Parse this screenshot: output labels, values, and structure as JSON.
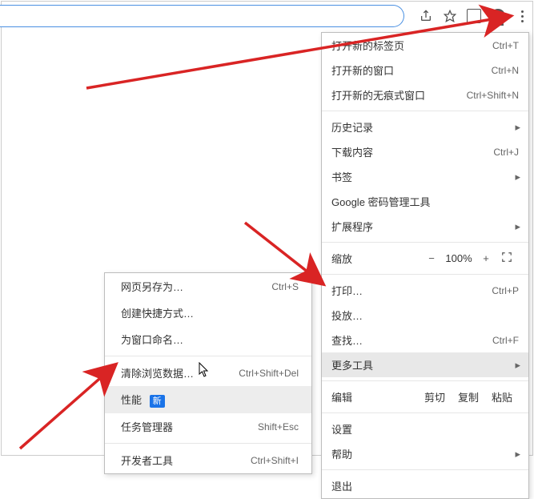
{
  "toolbar": {
    "share_icon": "share-icon",
    "star_icon": "star-icon",
    "extension_icon": "extension-icon",
    "profile_icon": "profile-icon",
    "kebab_icon": "kebab-menu-icon"
  },
  "main_menu": {
    "items": [
      {
        "label": "打开新的标签页",
        "shortcut": "Ctrl+T"
      },
      {
        "label": "打开新的窗口",
        "shortcut": "Ctrl+N"
      },
      {
        "label": "打开新的无痕式窗口",
        "shortcut": "Ctrl+Shift+N"
      }
    ],
    "history": {
      "label": "历史记录",
      "submenu": "▸"
    },
    "downloads": {
      "label": "下载内容",
      "shortcut": "Ctrl+J"
    },
    "bookmarks": {
      "label": "书签",
      "submenu": "▸"
    },
    "passwords": {
      "label": "Google 密码管理工具"
    },
    "extensions": {
      "label": "扩展程序",
      "submenu": "▸"
    },
    "zoom": {
      "label": "缩放",
      "minus": "−",
      "pct": "100%",
      "plus": "+",
      "fullscreen": "⛶"
    },
    "print": {
      "label": "打印…",
      "shortcut": "Ctrl+P"
    },
    "cast": {
      "label": "投放…"
    },
    "find": {
      "label": "查找…",
      "shortcut": "Ctrl+F"
    },
    "more_tools": {
      "label": "更多工具",
      "submenu": "▸"
    },
    "edit": {
      "label": "编辑",
      "cut": "剪切",
      "copy": "复制",
      "paste": "粘贴"
    },
    "settings": {
      "label": "设置"
    },
    "help": {
      "label": "帮助",
      "submenu": "▸"
    },
    "exit": {
      "label": "退出"
    }
  },
  "sub_menu": {
    "save_as": {
      "label": "网页另存为…",
      "shortcut": "Ctrl+S"
    },
    "create_shortcut": {
      "label": "创建快捷方式…"
    },
    "name_window": {
      "label": "为窗口命名…"
    },
    "clear_data": {
      "label": "清除浏览数据…",
      "shortcut": "Ctrl+Shift+Del"
    },
    "performance": {
      "label": "性能",
      "badge": "新"
    },
    "task_manager": {
      "label": "任务管理器",
      "shortcut": "Shift+Esc"
    },
    "dev_tools": {
      "label": "开发者工具",
      "shortcut": "Ctrl+Shift+I"
    }
  },
  "annotation": {
    "color": "#d92424"
  }
}
